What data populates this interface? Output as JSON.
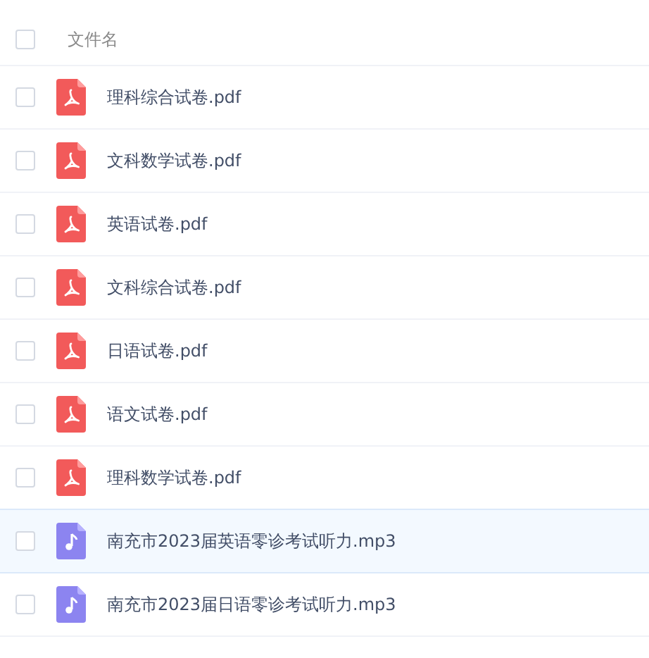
{
  "header": {
    "label": "文件名",
    "checked": false
  },
  "files": [
    {
      "name": "理科综合试卷.pdf",
      "kind": "pdf",
      "checked": false,
      "hovered": false
    },
    {
      "name": "文科数学试卷.pdf",
      "kind": "pdf",
      "checked": false,
      "hovered": false
    },
    {
      "name": "英语试卷.pdf",
      "kind": "pdf",
      "checked": false,
      "hovered": false
    },
    {
      "name": "文科综合试卷.pdf",
      "kind": "pdf",
      "checked": false,
      "hovered": false
    },
    {
      "name": "日语试卷.pdf",
      "kind": "pdf",
      "checked": false,
      "hovered": false
    },
    {
      "name": "语文试卷.pdf",
      "kind": "pdf",
      "checked": false,
      "hovered": false
    },
    {
      "name": "理科数学试卷.pdf",
      "kind": "pdf",
      "checked": false,
      "hovered": false
    },
    {
      "name": "南充市2023届英语零诊考试听力.mp3",
      "kind": "mp3",
      "checked": false,
      "hovered": true
    },
    {
      "name": "南充市2023届日语零诊考试听力.mp3",
      "kind": "mp3",
      "checked": false,
      "hovered": false
    }
  ]
}
